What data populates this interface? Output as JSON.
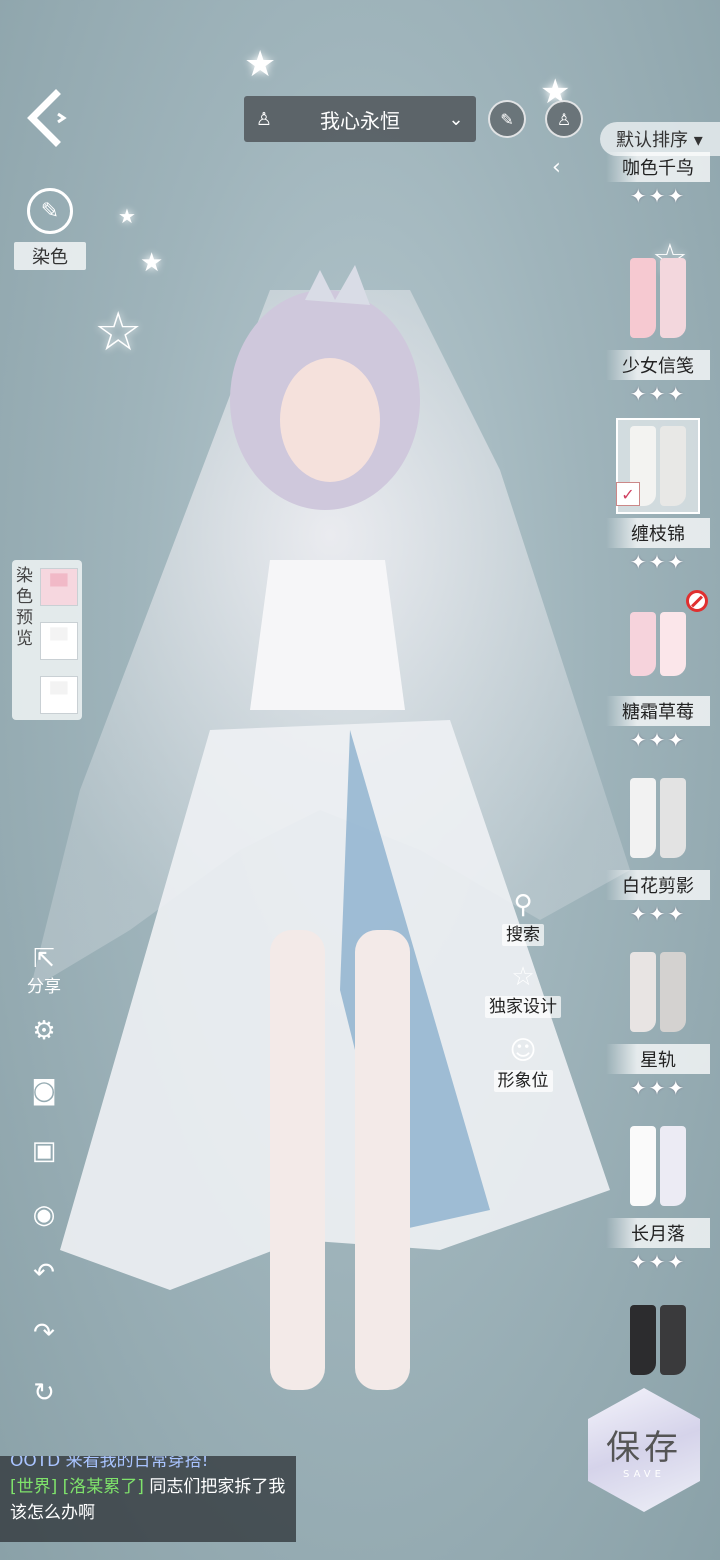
{
  "outfit": {
    "name": "我心永恒"
  },
  "sort": {
    "label": "默认排序 ▾"
  },
  "dye": {
    "label": "染色"
  },
  "dye_preview": {
    "label": "染色预览"
  },
  "share": {
    "label": "分享"
  },
  "actions": [
    {
      "label": "搜索",
      "icon": "search-icon"
    },
    {
      "label": "独家设计",
      "icon": "star-outline-icon"
    },
    {
      "label": "形象位",
      "icon": "portrait-icon"
    }
  ],
  "items": [
    {
      "name": "咖色千鸟",
      "stars": "✦✦✦",
      "colors": [
        "#e3c5a8",
        "#d8b69a"
      ]
    },
    {
      "name": "少女信笺",
      "stars": "✦✦✦",
      "colors": [
        "#f6c9d1",
        "#f3d7dd"
      ]
    },
    {
      "name": "缠枝锦",
      "stars": "✦✦✦",
      "colors": [
        "#f3f3f1",
        "#e8e8e6"
      ],
      "selected": true
    },
    {
      "name": "糖霜草莓",
      "stars": "✦✦✦",
      "colors": [
        "#f6d3dc",
        "#fbe6ea"
      ],
      "blocked": true
    },
    {
      "name": "白花剪影",
      "stars": "✦✦✦",
      "colors": [
        "#f2f2f2",
        "#e3e3e3"
      ]
    },
    {
      "name": "星轨",
      "stars": "✦✦✦",
      "colors": [
        "#e8e4e3",
        "#d4d2d0"
      ]
    },
    {
      "name": "长月落",
      "stars": "✦✦✦",
      "colors": [
        "#fafafa",
        "#ecebf4"
      ]
    }
  ],
  "save": {
    "label": "保存",
    "sub": "SAVE"
  },
  "chat": {
    "cut_line": "OOTD 来看我的日常穿搭!",
    "channel": "[世界]",
    "user": "[洛某累了]",
    "message": "同志们把家拆了我该怎么办啊"
  }
}
